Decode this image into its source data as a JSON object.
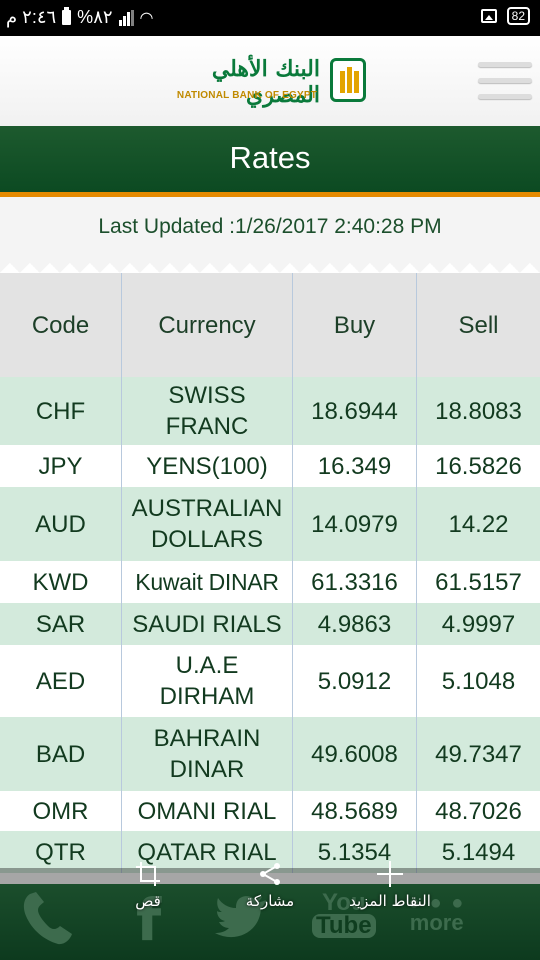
{
  "status_bar": {
    "time": "٢:٤٦ م",
    "battery_percent": "%٨٢",
    "battery_badge": "82"
  },
  "header": {
    "logo_arabic": "البنك الأهلي المصري",
    "logo_english": "NATIONAL BANK OF EGYPT"
  },
  "title": "Rates",
  "last_updated": "Last Updated :1/26/2017 2:40:28 PM",
  "table": {
    "headers": [
      "Code",
      "Currency",
      "Buy",
      "Sell"
    ],
    "rows": [
      {
        "code": "CHF",
        "currency": "SWISS FRANC",
        "buy": "18.6944",
        "sell": "18.8083"
      },
      {
        "code": "JPY",
        "currency": "YENS(100)",
        "buy": "16.349",
        "sell": "16.5826"
      },
      {
        "code": "AUD",
        "currency": "AUSTRALIAN DOLLARS",
        "buy": "14.0979",
        "sell": "14.22"
      },
      {
        "code": "KWD",
        "currency": "Kuwait DINAR",
        "buy": "61.3316",
        "sell": "61.5157"
      },
      {
        "code": "SAR",
        "currency": "SAUDI RIALS",
        "buy": "4.9863",
        "sell": "4.9997"
      },
      {
        "code": "AED",
        "currency": "U.A.E DIRHAM",
        "buy": "5.0912",
        "sell": "5.1048"
      },
      {
        "code": "BAD",
        "currency": "BAHRAIN DINAR",
        "buy": "49.6008",
        "sell": "49.7347"
      },
      {
        "code": "OMR",
        "currency": "OMANI RIAL",
        "buy": "48.5689",
        "sell": "48.7026"
      },
      {
        "code": "QTR",
        "currency": "QATAR RIAL",
        "buy": "5.1354",
        "sell": "5.1494"
      }
    ]
  },
  "share_actions": {
    "crop": "قص",
    "share": "مشاركة",
    "more_points": "النقاط المزيد"
  },
  "bottom_nav": {
    "youtube_top": "You",
    "youtube_bottom": "Tube",
    "more": "more"
  }
}
